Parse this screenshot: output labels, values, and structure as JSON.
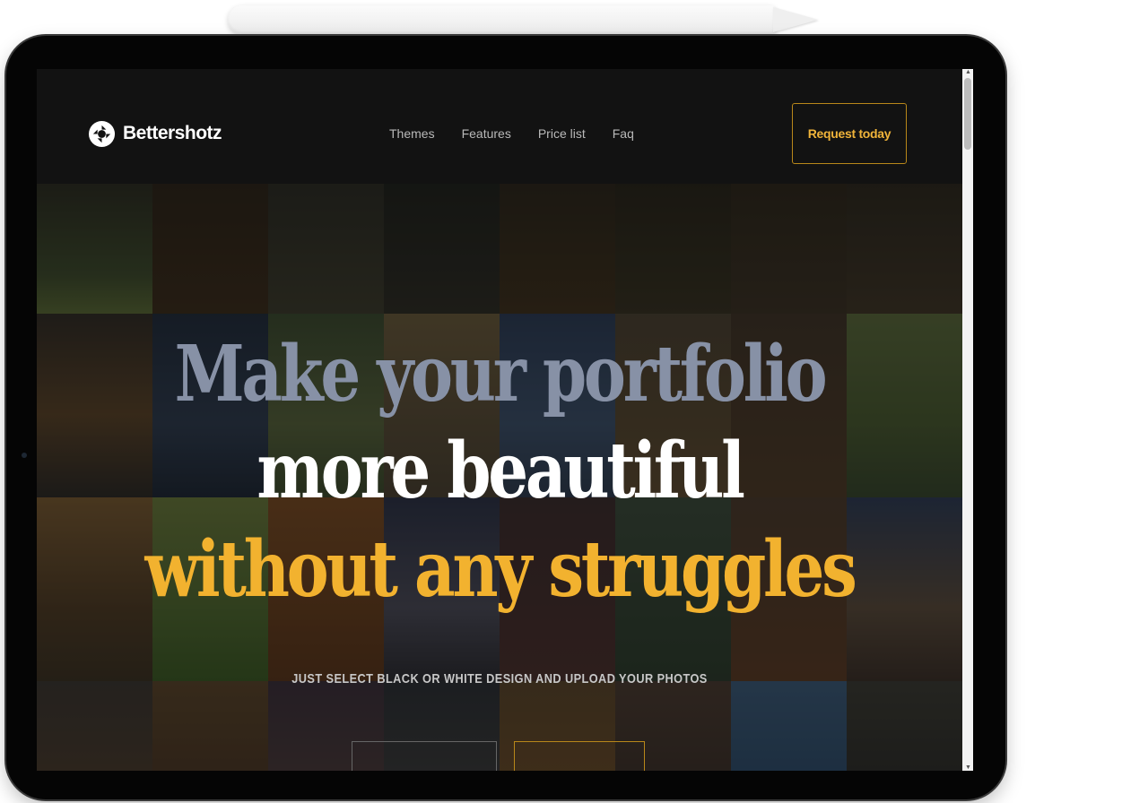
{
  "brand": {
    "name": "Bettershotz",
    "logo_icon": "aperture-icon"
  },
  "nav": {
    "items": [
      {
        "label": "Themes"
      },
      {
        "label": "Features"
      },
      {
        "label": "Price list"
      },
      {
        "label": "Faq"
      }
    ],
    "cta_label": "Request today"
  },
  "hero": {
    "line1": "Make your portfolio",
    "line2": "more beautiful",
    "line3": "without any struggles",
    "subtitle": "JUST SELECT BLACK OR WHITE DESIGN AND UPLOAD YOUR PHOTOS"
  },
  "colors": {
    "accent": "#f2b22f",
    "line1": "#8791a6",
    "background": "#121212"
  }
}
